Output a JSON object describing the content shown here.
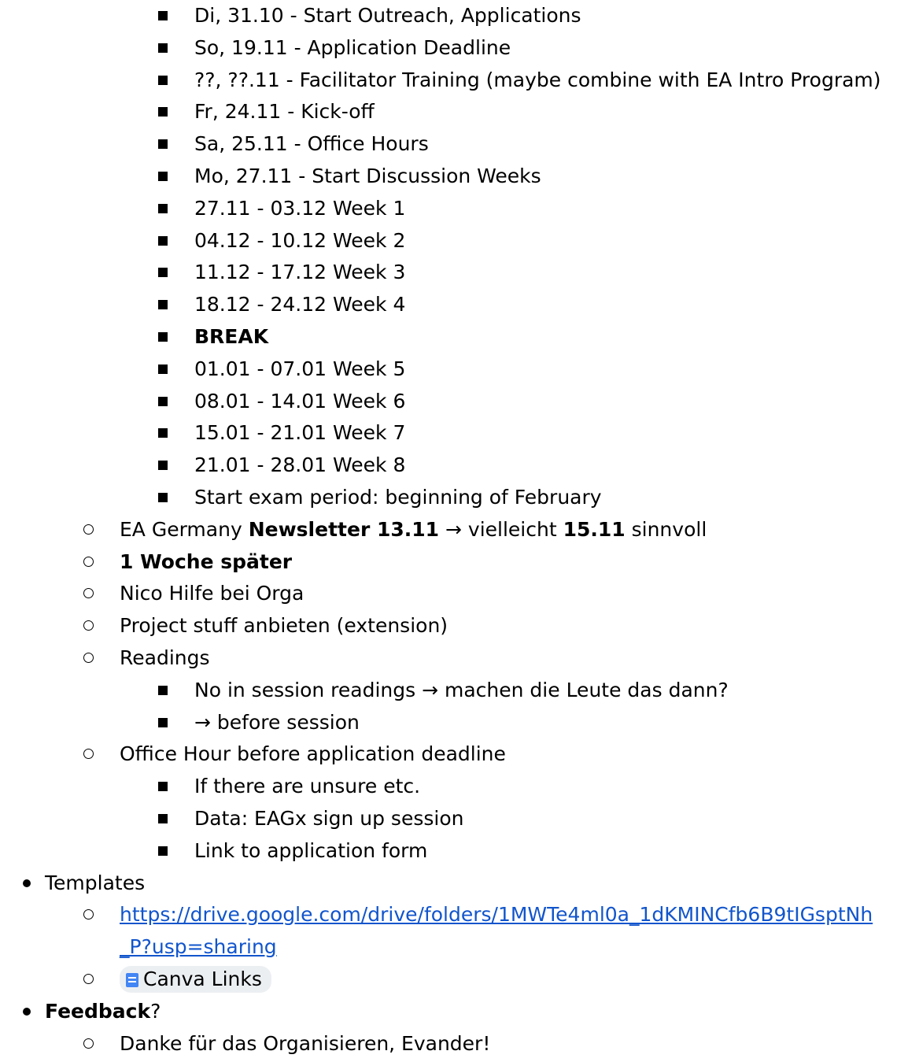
{
  "items": [
    {
      "level": 3,
      "segments": [
        {
          "t": "Di, 31.10 - Start Outreach, Applications"
        }
      ]
    },
    {
      "level": 3,
      "segments": [
        {
          "t": "So, 19.11 - Application Deadline"
        }
      ]
    },
    {
      "level": 3,
      "segments": [
        {
          "t": "??, ??.11 - Facilitator Training (maybe combine with EA Intro Program)"
        }
      ]
    },
    {
      "level": 3,
      "segments": [
        {
          "t": "Fr, 24.11 - Kick-off"
        }
      ]
    },
    {
      "level": 3,
      "segments": [
        {
          "t": "Sa, 25.11 - Office Hours"
        }
      ]
    },
    {
      "level": 3,
      "segments": [
        {
          "t": "Mo, 27.11 - Start Discussion Weeks"
        }
      ]
    },
    {
      "level": 3,
      "segments": [
        {
          "t": "27.11 - 03.12 Week 1"
        }
      ]
    },
    {
      "level": 3,
      "segments": [
        {
          "t": "04.12 - 10.12 Week 2"
        }
      ]
    },
    {
      "level": 3,
      "segments": [
        {
          "t": "11.12 - 17.12 Week 3"
        }
      ]
    },
    {
      "level": 3,
      "segments": [
        {
          "t": "18.12 - 24.12 Week 4"
        }
      ]
    },
    {
      "level": 3,
      "segments": [
        {
          "t": "BREAK",
          "bold": true
        }
      ]
    },
    {
      "level": 3,
      "segments": [
        {
          "t": "01.01 - 07.01 Week 5"
        }
      ]
    },
    {
      "level": 3,
      "segments": [
        {
          "t": "08.01 - 14.01 Week 6"
        }
      ]
    },
    {
      "level": 3,
      "segments": [
        {
          "t": "15.01 - 21.01 Week 7"
        }
      ]
    },
    {
      "level": 3,
      "segments": [
        {
          "t": "21.01 - 28.01 Week 8"
        }
      ]
    },
    {
      "level": 3,
      "segments": [
        {
          "t": "Start exam period: beginning of February"
        }
      ]
    },
    {
      "level": 2,
      "segments": [
        {
          "t": "EA Germany "
        },
        {
          "t": "Newsletter 13.11",
          "bold": true
        },
        {
          "t": " → vielleicht "
        },
        {
          "t": "15.11",
          "bold": true
        },
        {
          "t": " sinnvoll"
        }
      ]
    },
    {
      "level": 2,
      "segments": [
        {
          "t": "1 Woche später",
          "bold": true
        }
      ]
    },
    {
      "level": 2,
      "segments": [
        {
          "t": "Nico Hilfe bei Orga"
        }
      ]
    },
    {
      "level": 2,
      "segments": [
        {
          "t": "Project stuff anbieten (extension)"
        }
      ]
    },
    {
      "level": 2,
      "segments": [
        {
          "t": "Readings"
        }
      ]
    },
    {
      "level": 3,
      "segments": [
        {
          "t": "No in session readings → machen die Leute das dann?"
        }
      ]
    },
    {
      "level": 3,
      "segments": [
        {
          "t": "→ before session"
        }
      ]
    },
    {
      "level": 2,
      "segments": [
        {
          "t": "Office Hour before application deadline"
        }
      ]
    },
    {
      "level": 3,
      "segments": [
        {
          "t": "If there are unsure etc."
        }
      ]
    },
    {
      "level": 3,
      "segments": [
        {
          "t": "Data: EAGx sign up session"
        }
      ]
    },
    {
      "level": 3,
      "segments": [
        {
          "t": "Link to application form"
        }
      ]
    },
    {
      "level": 1,
      "segments": [
        {
          "t": "Templates"
        }
      ]
    },
    {
      "level": 2,
      "segments": [
        {
          "t": "https://drive.google.com/drive/folders/1MWTe4ml0a_1dKMINCfb6B9tIGsptNh",
          "link": true
        }
      ]
    },
    {
      "level": 0,
      "segments": [
        {
          "t": "_P?usp=sharing",
          "link": true
        }
      ]
    },
    {
      "level": 2,
      "segments": [
        {
          "t": "Canva Links",
          "chip": true,
          "icon": "document-icon"
        }
      ]
    },
    {
      "level": 1,
      "segments": [
        {
          "t": "Feedback",
          "bold": true
        },
        {
          "t": "?"
        }
      ]
    },
    {
      "level": 2,
      "segments": [
        {
          "t": "Danke für das Organisieren, Evander!"
        }
      ]
    }
  ]
}
